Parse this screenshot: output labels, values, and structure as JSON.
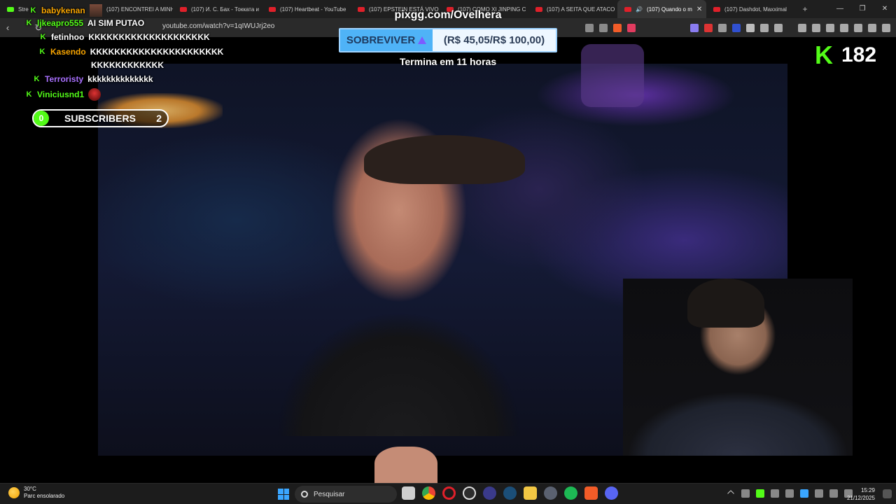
{
  "browser": {
    "tabs": [
      {
        "label": "Stre",
        "active": false
      },
      {
        "label": "(107) ENCONTREI A MINH",
        "active": false
      },
      {
        "label": "(107) И. С. Бах - Токката и",
        "active": false
      },
      {
        "label": "(107) Heartbeat - YouTube",
        "active": false
      },
      {
        "label": "(107) EPSTEIN ESTÁ VIVO",
        "active": false
      },
      {
        "label": "(107) COMO XI JINPING C",
        "active": false
      },
      {
        "label": "(107) A SEITA QUE ATACO",
        "active": false
      },
      {
        "label": "(107) Quando o m",
        "active": true
      },
      {
        "label": "(107) Dashdot, Maxximal",
        "active": false
      }
    ],
    "url": "youtube.com/watch?v=1qIWUJrj2eo",
    "new_tab": "+",
    "close_tab": "✕"
  },
  "overlay": {
    "donation_url": "pixgg.com/Ovelhera",
    "goal_label": "SOBREVIVER",
    "goal_amount": "(R$ 45,05/R$ 100,00)",
    "timer": "Termina em 11 horas",
    "viewer_count": "182",
    "subscribers": {
      "current": "0",
      "label": "SUBSCRIBERS",
      "target": "2"
    }
  },
  "chat": [
    {
      "user": "babykenan",
      "text": "",
      "color": "#f7a400"
    },
    {
      "user": "ljkeapro555",
      "text": "AI SIM PUTAO",
      "color": "#53fc18"
    },
    {
      "user": "fetinhoo",
      "text": "KKKKKKKKKKKKKKKKKKKK",
      "color": "#ffffff"
    },
    {
      "user": "Kasendo",
      "text": "KKKKKKKKKKKKKKKKKKKKKK",
      "color": "#f7a400"
    },
    {
      "user": "",
      "text": "KKKKKKKKKKKK",
      "color": "#ffffff"
    },
    {
      "user": "Terroristy",
      "text": "kkkkkkkkkkkkkk",
      "color": "#a970ff"
    },
    {
      "user": "Viniciusnd1",
      "text": "",
      "color": "#53fc18"
    }
  ],
  "taskbar": {
    "temperature": "30°C",
    "weather": "Parc ensolarado",
    "search_placeholder": "Pesquisar",
    "time": "15:29",
    "date": "21/12/2025"
  }
}
